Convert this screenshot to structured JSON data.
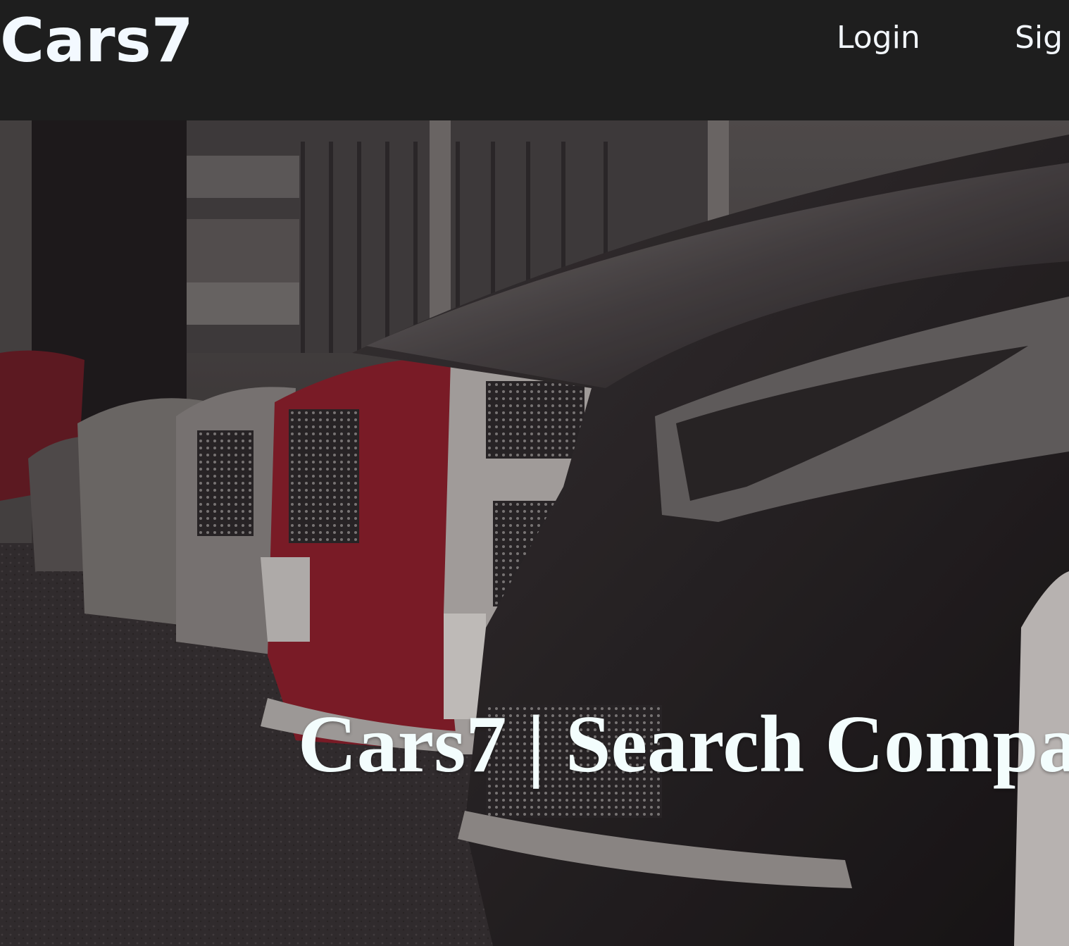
{
  "navbar": {
    "brand": "Cars7",
    "links": [
      {
        "label": "Login"
      },
      {
        "label": "Sig"
      }
    ]
  },
  "hero": {
    "title": "Cars7 | Search Compa",
    "background_image": "photo of a row of parked cars in front of a building"
  },
  "colors": {
    "navbar_bg": "#1e1e1e",
    "brand_text": "#f3f9ff",
    "hero_title": "#f3fdfd",
    "accent_red": "#8e1d2a"
  }
}
